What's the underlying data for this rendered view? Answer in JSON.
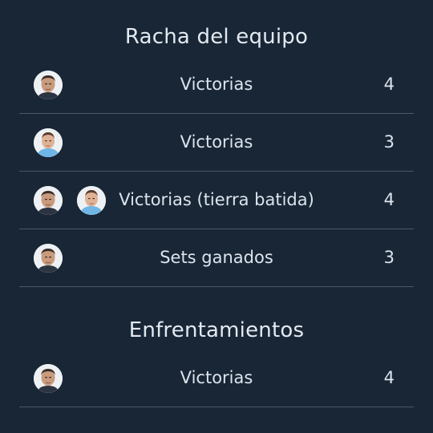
{
  "streak": {
    "title": "Racha del equipo",
    "rows": [
      {
        "label": "Victorias",
        "value": "4"
      },
      {
        "label": "Victorias",
        "value": "3"
      },
      {
        "label": "Victorias (tierra batida)",
        "value": "4"
      },
      {
        "label": "Sets ganados",
        "value": "3"
      }
    ]
  },
  "h2h": {
    "title": "Enfrentamientos",
    "rows": [
      {
        "label": "Victorias",
        "value": "4"
      }
    ]
  },
  "colors": {
    "background": "#182636",
    "divider": "#4a5868",
    "text": "#dde4ec"
  }
}
